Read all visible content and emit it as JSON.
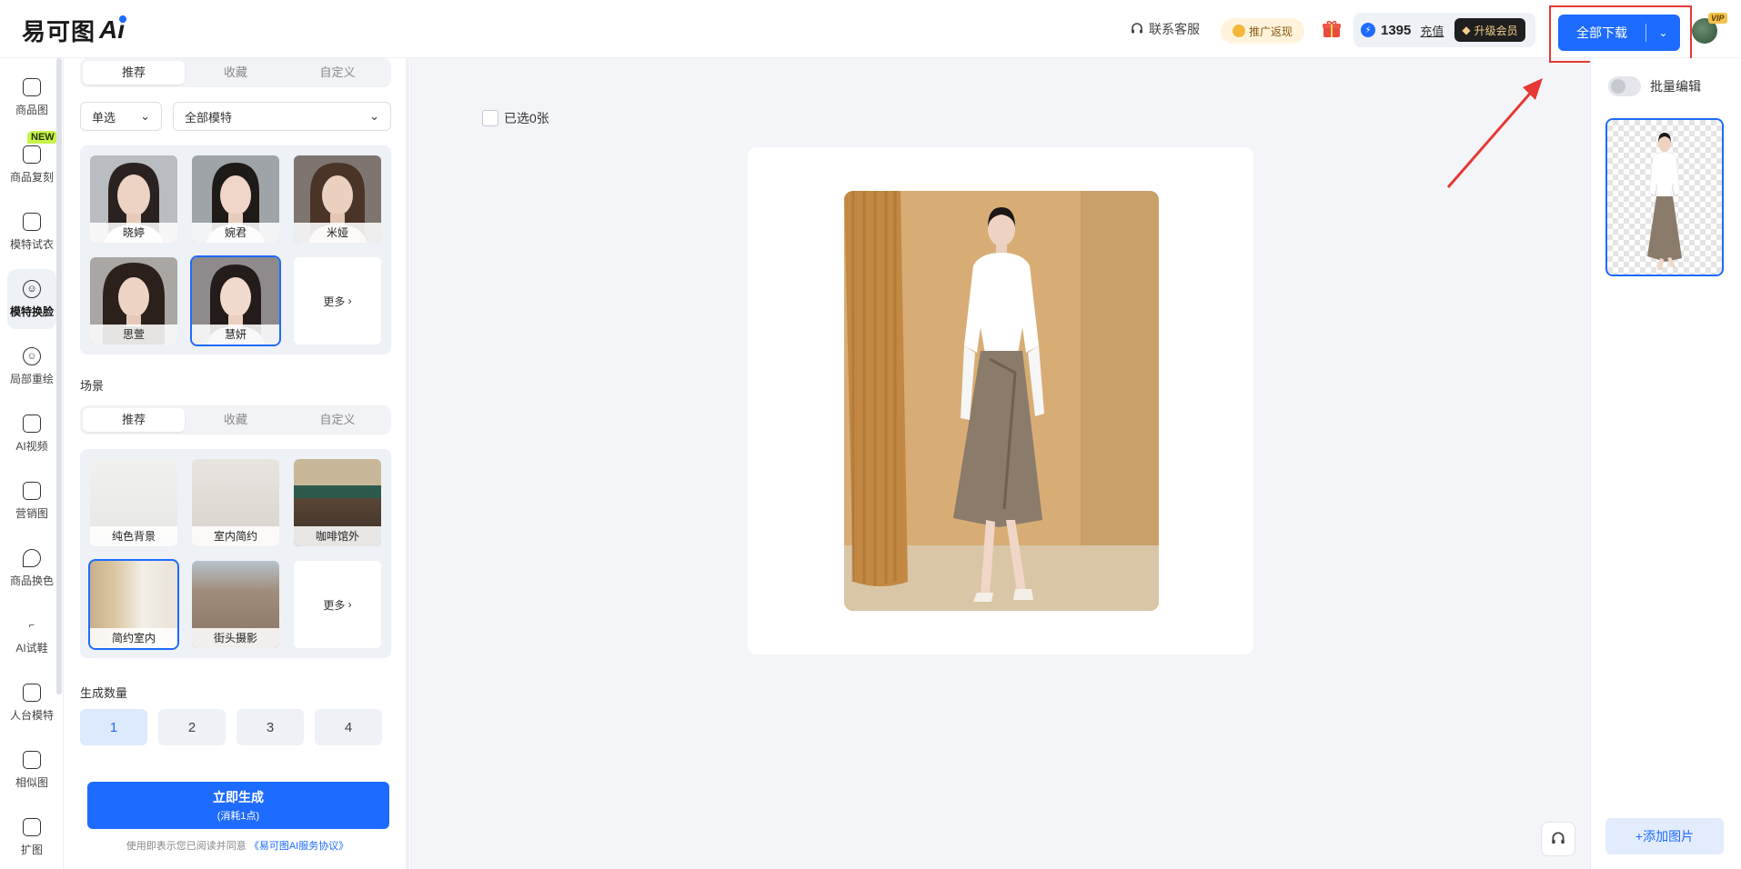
{
  "app": {
    "logo_text": "易可图",
    "logo_ai": "Ai"
  },
  "topbar": {
    "service_label": "联系客服",
    "promo_label": "推广返现",
    "credits": "1395",
    "recharge_label": "充值",
    "upgrade_label": "升级会员",
    "download_label": "全部下载",
    "vip_tag": "VIP"
  },
  "nav": [
    {
      "label": "商品图",
      "icon": "bag-icon"
    },
    {
      "label": "商品复刻",
      "icon": "copy-bag-icon",
      "badge": "NEW"
    },
    {
      "label": "模特试衣",
      "icon": "shirt-icon"
    },
    {
      "label": "模特换脸",
      "icon": "face-icon",
      "active": true
    },
    {
      "label": "局部重绘",
      "icon": "face-edit-icon"
    },
    {
      "label": "AI视频",
      "icon": "video-icon"
    },
    {
      "label": "营销图",
      "icon": "poster-icon"
    },
    {
      "label": "商品换色",
      "icon": "color-drop-icon"
    },
    {
      "label": "AI试鞋",
      "icon": "shoe-icon"
    },
    {
      "label": "人台模特",
      "icon": "mannequin-icon"
    },
    {
      "label": "相似图",
      "icon": "similar-image-icon"
    },
    {
      "label": "扩图",
      "icon": "expand-image-icon"
    }
  ],
  "model_section": {
    "tabs": [
      "推荐",
      "收藏",
      "自定义"
    ],
    "active_tab": "推荐",
    "select_mode": "单选",
    "select_model": "全部模特",
    "cards": [
      {
        "label": "晓婷"
      },
      {
        "label": "婉君"
      },
      {
        "label": "米娅"
      },
      {
        "label": "思萱"
      },
      {
        "label": "慧妍",
        "selected": true
      }
    ],
    "more_label": "更多"
  },
  "scene_section": {
    "title": "场景",
    "tabs": [
      "推荐",
      "收藏",
      "自定义"
    ],
    "active_tab": "推荐",
    "cards": [
      {
        "label": "纯色背景"
      },
      {
        "label": "室内简约"
      },
      {
        "label": "咖啡馆外"
      },
      {
        "label": "简约室内",
        "selected": true
      },
      {
        "label": "街头摄影"
      }
    ],
    "more_label": "更多"
  },
  "quantity": {
    "title": "生成数量",
    "options": [
      "1",
      "2",
      "3",
      "4"
    ],
    "selected": "1"
  },
  "generate": {
    "label": "立即生成",
    "cost": "(消耗1点)",
    "agree_prefix": "使用即表示您已阅读并同意",
    "agree_link": "《易可图AI服务协议》"
  },
  "workspace": {
    "selected_count_label": "已选0张"
  },
  "right_panel": {
    "batch_edit_label": "批量编辑",
    "add_image_label": "+添加图片"
  },
  "colors": {
    "primary": "#1e6bff",
    "highlight_box": "#e53935"
  }
}
